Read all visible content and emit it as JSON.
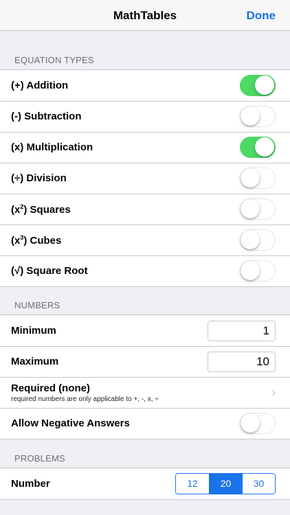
{
  "nav": {
    "title": "MathTables",
    "done_label": "Done"
  },
  "equation_types": {
    "header": "EQUATION TYPES",
    "items": [
      {
        "label": "(+) Addition",
        "on": true
      },
      {
        "label": "(-) Subtraction",
        "on": false
      },
      {
        "label": "(x) Multiplication",
        "on": true
      },
      {
        "label": "(÷) Division",
        "on": false
      },
      {
        "prefix": "(x",
        "sup": "2",
        "suffix": ") Squares",
        "on": false
      },
      {
        "prefix": "(x",
        "sup": "3",
        "suffix": ") Cubes",
        "on": false
      },
      {
        "label": "(√) Square Root",
        "on": false
      }
    ]
  },
  "numbers": {
    "header": "NUMBERS",
    "minimum_label": "Minimum",
    "minimum_value": "1",
    "maximum_label": "Maximum",
    "maximum_value": "10",
    "required_title": "Required (none)",
    "required_subtitle": "required numbers are only applicable to +, -, x, ÷",
    "allow_negative_label": "Allow Negative Answers",
    "allow_negative_on": false
  },
  "problems": {
    "header": "PROBLEMS",
    "number_label": "Number",
    "options": [
      "12",
      "20",
      "30"
    ],
    "selected": "20"
  },
  "colors": {
    "accent": "#1a73e8",
    "toggle_on": "#4cd964",
    "background": "#efeff4"
  },
  "icons": {
    "chevron": "chevron-right-icon"
  }
}
